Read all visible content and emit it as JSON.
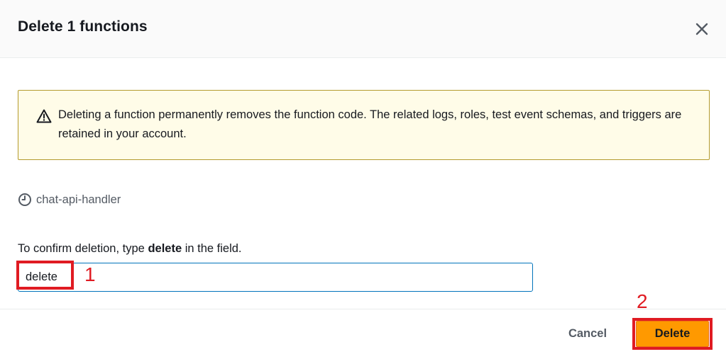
{
  "modal": {
    "title": "Delete 1 functions",
    "close_icon": "close-icon"
  },
  "alert": {
    "icon": "warning-icon",
    "message": "Deleting a function permanently removes the function code. The related logs, roles, test event schemas, and triggers are retained in your account."
  },
  "function_item": {
    "icon": "clock-icon",
    "name": "chat-api-handler"
  },
  "confirm": {
    "prefix": "To confirm deletion, type ",
    "keyword": "delete",
    "suffix": " in the field.",
    "input_value": "delete"
  },
  "footer": {
    "cancel_label": "Cancel",
    "delete_label": "Delete"
  },
  "annotations": {
    "step1": "1",
    "step2": "2",
    "color": "#e01b22"
  },
  "colors": {
    "accent_orange": "#ff9900",
    "focus_blue": "#0073bb",
    "alert_bg": "#fffce8",
    "alert_border": "#b49a2d"
  }
}
